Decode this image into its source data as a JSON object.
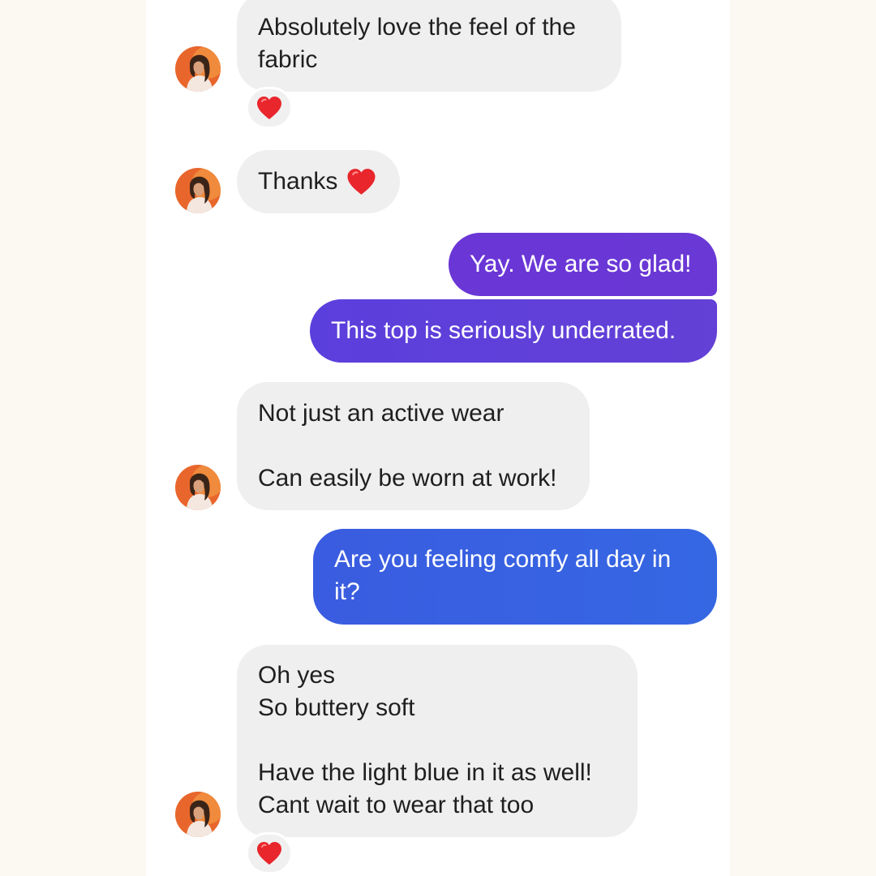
{
  "colors": {
    "page_background": "#fcf8f2",
    "chat_background": "#ffffff",
    "incoming_bubble": "#efefef",
    "outgoing_purple": "#6a36d6",
    "outgoing_indigo": "#5b42df",
    "outgoing_blue": "#3567e3",
    "reaction_heart": "#e8262c"
  },
  "messages": [
    {
      "sender": "them",
      "text": "Absolutely love the feel of the\nfabric",
      "reaction": "heart-icon"
    },
    {
      "sender": "them",
      "text": "Thanks",
      "inline_emoji": "heart-icon"
    },
    {
      "sender": "me",
      "text": "Yay. We are so glad!"
    },
    {
      "sender": "me",
      "text": "This top is seriously underrated."
    },
    {
      "sender": "them",
      "text": "Not just an active wear\n\nCan easily be worn at work!"
    },
    {
      "sender": "me",
      "text": "Are you feeling comfy all day in\nit?"
    },
    {
      "sender": "them",
      "text": "Oh yes\nSo buttery soft\n\nHave the light blue in it as well!\nCant wait to wear that too",
      "reaction": "heart-icon"
    }
  ]
}
